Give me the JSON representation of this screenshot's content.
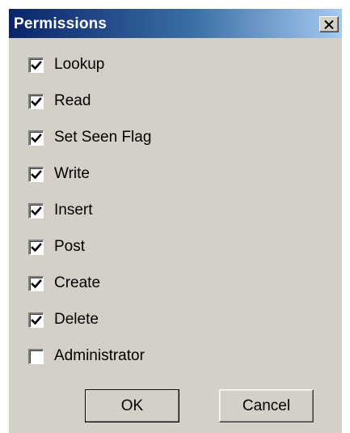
{
  "window": {
    "title": "Permissions",
    "close_icon": "close-icon"
  },
  "permissions": [
    {
      "label": "Lookup",
      "checked": true
    },
    {
      "label": "Read",
      "checked": true
    },
    {
      "label": "Set Seen Flag",
      "checked": true
    },
    {
      "label": "Write",
      "checked": true
    },
    {
      "label": "Insert",
      "checked": true
    },
    {
      "label": "Post",
      "checked": true
    },
    {
      "label": "Create",
      "checked": true
    },
    {
      "label": "Delete",
      "checked": true
    },
    {
      "label": "Administrator",
      "checked": false
    }
  ],
  "buttons": {
    "ok_label": "OK",
    "cancel_label": "Cancel"
  },
  "colors": {
    "titlebar_start": "#0a246a",
    "titlebar_end": "#a6caf0",
    "dialog_bg": "#d4d0c8"
  }
}
